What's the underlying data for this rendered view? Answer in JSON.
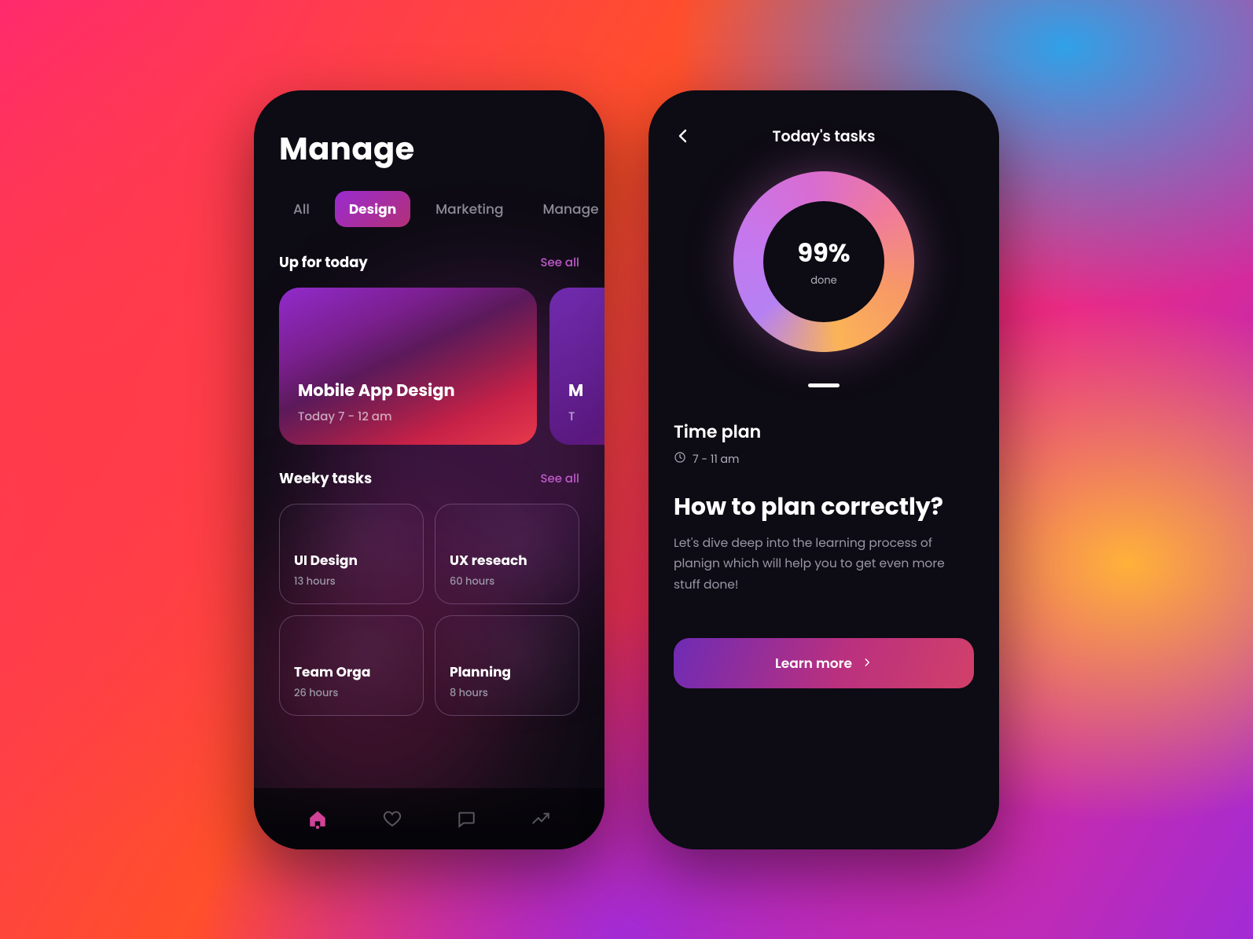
{
  "screen1": {
    "title": "Manage",
    "tabs": [
      "All",
      "Design",
      "Marketing",
      "Manage"
    ],
    "activeTabIndex": 1,
    "upForToday": {
      "heading": "Up for today",
      "seeAll": "See all"
    },
    "todayCards": [
      {
        "title": "Mobile App Design",
        "time": "Today 7 - 12 am"
      },
      {
        "title": "M",
        "time": "T"
      }
    ],
    "weeky": {
      "heading": "Weeky tasks",
      "seeAll": "See all"
    },
    "weekyTasks": [
      {
        "title": "UI Design",
        "hours": "13 hours"
      },
      {
        "title": "UX reseach",
        "hours": "60 hours"
      },
      {
        "title": "Team Orga",
        "hours": "26 hours"
      },
      {
        "title": "Planning",
        "hours": "8 hours"
      }
    ],
    "nav": [
      "home-icon",
      "heart-icon",
      "chat-icon",
      "trend-icon"
    ]
  },
  "screen2": {
    "header": "Today's tasks",
    "progress": {
      "percent": "99%",
      "label": "done"
    },
    "timeplan": {
      "heading": "Time plan",
      "range": "7 - 11 am"
    },
    "article": {
      "title": "How to plan correctly?",
      "body": "Let's dive deep into the learning process of planign which will help you to get even more stuff done!"
    },
    "cta": "Learn more"
  },
  "colors": {
    "accentPurple": "#9a2bd0",
    "accentPink": "#c62147",
    "phoneBg": "#0d0b13"
  }
}
